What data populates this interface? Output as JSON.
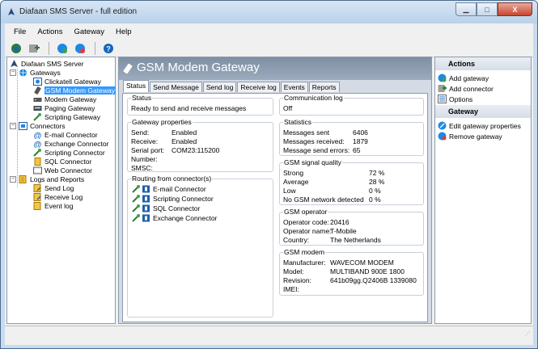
{
  "window": {
    "title": "Diafaan SMS Server - full edition",
    "buttons": {
      "minimize": "▁",
      "maximize": "□",
      "close": "X"
    }
  },
  "menubar": [
    "File",
    "Actions",
    "Gateway",
    "Help"
  ],
  "toolbar": {
    "icons": [
      "connect-icon",
      "add-icon",
      "gateway-icon",
      "gateway-remove-icon",
      "help-icon"
    ]
  },
  "tree": {
    "root": "Diafaan SMS Server",
    "gateways_label": "Gateways",
    "gateways": [
      "Clickatell Gateway",
      "GSM Modem Gateway",
      "Modem Gateway",
      "Paging Gateway",
      "Scripting Gateway"
    ],
    "connectors_label": "Connectors",
    "connectors": [
      "E-mail Connector",
      "Exchange Connector",
      "Scripting Connector",
      "SQL Connector",
      "Web Connector"
    ],
    "logs_label": "Logs and Reports",
    "logs": [
      "Send Log",
      "Receive Log",
      "Event log"
    ]
  },
  "center": {
    "title": "GSM Modem Gateway",
    "tabs": [
      "Status",
      "Send Message",
      "Send log",
      "Receive log",
      "Events",
      "Reports"
    ],
    "status": {
      "label": "Status",
      "text": "Ready to send and receive messages"
    },
    "gateway_properties": {
      "label": "Gateway properties",
      "rows": [
        {
          "k": "Send:",
          "v": "Enabled"
        },
        {
          "k": "Receive:",
          "v": "Enabled"
        },
        {
          "k": "Serial port:",
          "v": "COM23:115200"
        },
        {
          "k": "Number:",
          "v": ""
        },
        {
          "k": "SMSC:",
          "v": ""
        }
      ]
    },
    "routing": {
      "label": "Routing from connector(s)",
      "items": [
        "E-mail Connector",
        "Scripting Connector",
        "SQL Connector",
        "Exchange Connector"
      ]
    },
    "communication_log": {
      "label": "Communication log",
      "value": "Off"
    },
    "statistics": {
      "label": "Statistics",
      "rows": [
        {
          "k": "Messages sent",
          "v": "6406"
        },
        {
          "k": "Messages received:",
          "v": "1879"
        },
        {
          "k": "Message send errors:",
          "v": "65"
        }
      ]
    },
    "signal": {
      "label": "GSM signal quality",
      "rows": [
        {
          "k": "Strong",
          "v": "72 %"
        },
        {
          "k": "Average",
          "v": "28 %"
        },
        {
          "k": "Low",
          "v": "0 %"
        },
        {
          "k": "No GSM network detected",
          "v": "0 %"
        }
      ]
    },
    "operator": {
      "label": "GSM operator",
      "rows": [
        {
          "k": "Operator code:",
          "v": "20416"
        },
        {
          "k": "Operator name:",
          "v": "T-Mobile"
        },
        {
          "k": "Country:",
          "v": "The Netherlands"
        }
      ]
    },
    "modem": {
      "label": "GSM modem",
      "rows": [
        {
          "k": "Manufacturer:",
          "v": "WAVECOM MODEM"
        },
        {
          "k": "Model:",
          "v": "MULTIBAND  900E  1800"
        },
        {
          "k": "Revision:",
          "v": "641b09gg.Q2406B 1339080"
        },
        {
          "k": "IMEI:",
          "v": ""
        }
      ]
    }
  },
  "actions": {
    "header": "Actions",
    "items": [
      "Add gateway",
      "Add connector",
      "Options"
    ],
    "gateway_header": "Gateway",
    "gateway_items": [
      "Edit gateway properties",
      "Remove gateway"
    ]
  },
  "colors": {
    "selection": "#3399ff",
    "header": "#8a99ad",
    "frame": "#c9dbee"
  }
}
